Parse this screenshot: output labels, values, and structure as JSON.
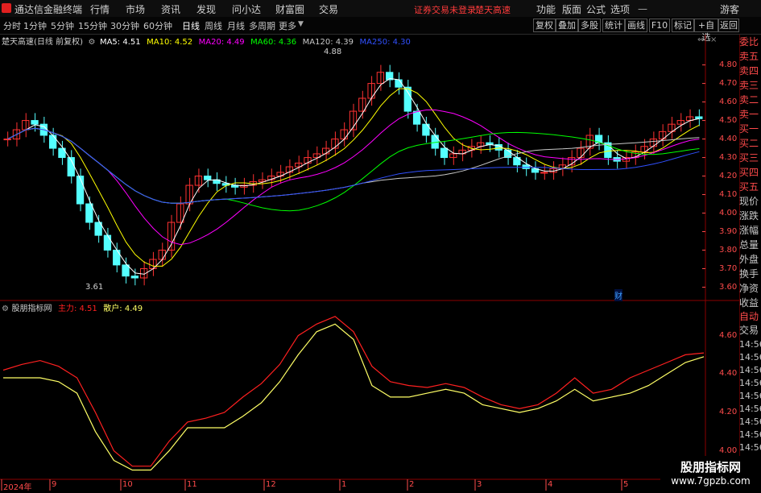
{
  "menubar": {
    "app_title": "通达信金融终端",
    "items": [
      "行情",
      "市场",
      "资讯",
      "发现",
      "问小达",
      "财富圈",
      "交易"
    ],
    "login_status": "证券交易未登录",
    "stock_name_red": "楚天高速",
    "right_items": [
      "功能",
      "版面",
      "公式",
      "选项"
    ],
    "guest": "游客"
  },
  "period_tabs": [
    "分时",
    "1分钟",
    "5分钟",
    "15分钟",
    "30分钟",
    "60分钟",
    "日线",
    "周线",
    "月线",
    "多周期",
    "更多"
  ],
  "active_tab": "日线",
  "toolbar_buttons": [
    "复权",
    "叠加",
    "多股",
    "统计",
    "画线",
    "F10",
    "标记",
    "+自选",
    "返回"
  ],
  "main_chart": {
    "stock_title": "楚天高速(日线 前复权)",
    "ma_legend": [
      {
        "label": "MA5: 4.51",
        "color": "#ffffff"
      },
      {
        "label": "MA10: 4.52",
        "color": "#ffff00"
      },
      {
        "label": "MA20: 4.49",
        "color": "#ff00ff"
      },
      {
        "label": "MA60: 4.36",
        "color": "#00ff00"
      },
      {
        "label": "MA120: 4.39",
        "color": "#c8c8c8"
      },
      {
        "label": "MA250: 4.30",
        "color": "#3050ff"
      }
    ],
    "high_mark": "4.88",
    "low_mark": "3.61",
    "fin_marker": "财",
    "yticks": [
      "4.80",
      "4.70",
      "4.60",
      "4.50",
      "4.40",
      "4.30",
      "4.20",
      "4.10",
      "4.00",
      "3.90",
      "3.80",
      "3.70",
      "3.60"
    ]
  },
  "indicator": {
    "name": "股朋指标网",
    "main_label": "主力: 4.51",
    "retail_label": "散户: 4.49",
    "yticks": [
      "4.60",
      "4.40",
      "4.20",
      "4.00"
    ]
  },
  "side_panel": {
    "items": [
      "委比",
      "卖五",
      "卖四",
      "卖三",
      "卖二",
      "卖一",
      "买一",
      "买二",
      "买三",
      "买四",
      "买五",
      "现价",
      "涨跌",
      "涨幅",
      "总量",
      "外盘",
      "换手",
      "净资",
      "收益"
    ],
    "lower_items": [
      "自动",
      "交易"
    ],
    "times": [
      "14:56",
      "14:56",
      "14:56",
      "14:56",
      "14:56",
      "14:56",
      "14:56",
      "14:56",
      "14:56",
      "14:56",
      "14:56",
      "14:56"
    ]
  },
  "xaxis": {
    "labels": [
      "2024年",
      "9",
      "10",
      "11",
      "12",
      "1",
      "2",
      "3",
      "4",
      "5"
    ]
  },
  "watermark": {
    "line1": "股朋指标网",
    "line2": "www.7gpzb.com"
  },
  "colors": {
    "up": "#ff3232",
    "down": "#54ffff",
    "axis_red": "#ff4b4b",
    "ma5": "#ffffff",
    "ma10": "#ffff00",
    "ma20": "#ff00ff",
    "ma60": "#00ff00",
    "ma120": "#c8c8c8",
    "ma250": "#3050ff",
    "main_line": "#ff2020",
    "retail_line": "#ffff66"
  },
  "chart_data": {
    "type": "candlestick",
    "price_ylim": [
      3.55,
      4.92
    ],
    "price_series_close": [
      4.4,
      4.45,
      4.5,
      4.48,
      4.42,
      4.35,
      4.3,
      4.2,
      4.05,
      3.95,
      3.88,
      3.8,
      3.72,
      3.66,
      3.65,
      3.7,
      3.75,
      3.8,
      3.95,
      4.05,
      4.15,
      4.2,
      4.18,
      4.16,
      4.15,
      4.14,
      4.15,
      4.17,
      4.18,
      4.2,
      4.22,
      4.25,
      4.27,
      4.3,
      4.32,
      4.35,
      4.4,
      4.45,
      4.55,
      4.62,
      4.7,
      4.76,
      4.72,
      4.68,
      4.55,
      4.48,
      4.42,
      4.35,
      4.3,
      4.32,
      4.34,
      4.36,
      4.38,
      4.37,
      4.34,
      4.3,
      4.26,
      4.24,
      4.22,
      4.22,
      4.24,
      4.26,
      4.3,
      4.35,
      4.42,
      4.38,
      4.3,
      4.28,
      4.3,
      4.33,
      4.36,
      4.4,
      4.44,
      4.48,
      4.5,
      4.52,
      4.51
    ],
    "indicator_ylim": [
      3.86,
      4.72
    ],
    "main_force": [
      4.42,
      4.45,
      4.47,
      4.44,
      4.38,
      4.2,
      4.0,
      3.92,
      3.92,
      4.05,
      4.15,
      4.17,
      4.2,
      4.28,
      4.35,
      4.45,
      4.6,
      4.66,
      4.7,
      4.62,
      4.44,
      4.36,
      4.34,
      4.33,
      4.35,
      4.33,
      4.28,
      4.24,
      4.22,
      4.24,
      4.3,
      4.38,
      4.3,
      4.32,
      4.38,
      4.42,
      4.46,
      4.5,
      4.51
    ],
    "retail": [
      4.38,
      4.38,
      4.38,
      4.36,
      4.3,
      4.1,
      3.95,
      3.9,
      3.9,
      4.0,
      4.12,
      4.12,
      4.12,
      4.18,
      4.25,
      4.36,
      4.5,
      4.62,
      4.66,
      4.58,
      4.34,
      4.28,
      4.28,
      4.3,
      4.32,
      4.3,
      4.24,
      4.22,
      4.2,
      4.22,
      4.26,
      4.32,
      4.26,
      4.28,
      4.3,
      4.34,
      4.4,
      4.46,
      4.49
    ]
  }
}
